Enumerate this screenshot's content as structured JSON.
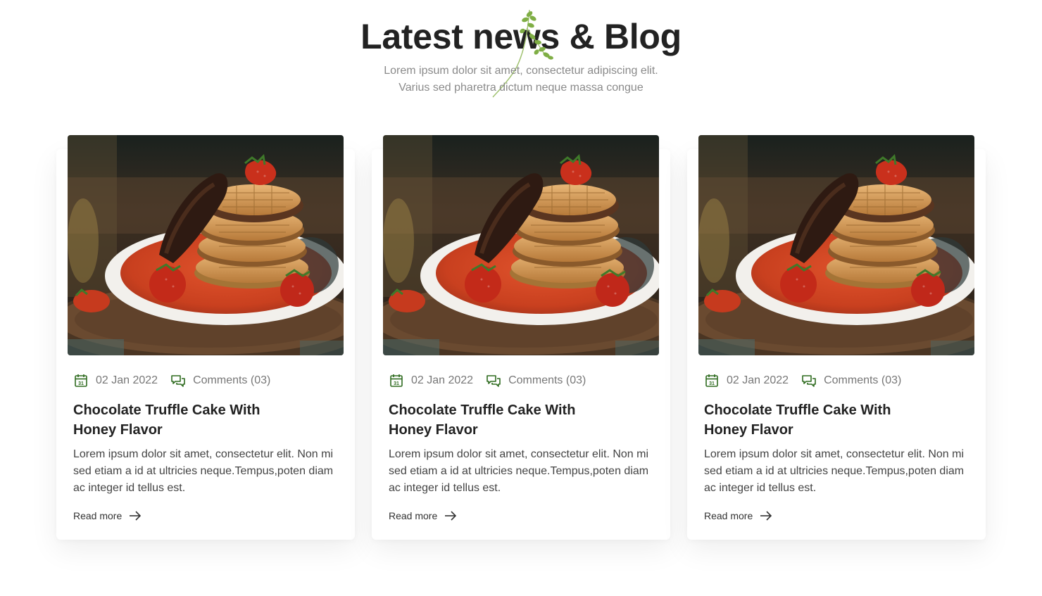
{
  "section": {
    "title": "Latest news & Blog",
    "subtitle_line1": "Lorem ipsum dolor sit amet, consectetur adipiscing elit.",
    "subtitle_line2": "Varius sed pharetra dictum neque massa congue"
  },
  "colors": {
    "accent_green": "#2e6b1f",
    "title": "#222222",
    "muted": "#8a8a8a"
  },
  "icons": {
    "date": "calendar-icon",
    "comments": "chat-bubbles-icon",
    "read_more": "arrow-right-icon",
    "decoration": "herb-sprig-icon"
  },
  "posts": [
    {
      "date": "02 Jan 2022",
      "comments": "Comments (03)",
      "title_line1": "Chocolate Truffle Cake With",
      "title_line2": "Honey Flavor",
      "excerpt_line1": "Lorem ipsum dolor sit amet, consectetur elit. Non mi",
      "excerpt_line2": "sed etiam a id at ultricies neque.Tempus,poten diam",
      "excerpt_line3": "ac integer id tellus est.",
      "read_more": "Read more"
    },
    {
      "date": "02 Jan 2022",
      "comments": "Comments (03)",
      "title_line1": "Chocolate Truffle Cake With",
      "title_line2": "Honey Flavor",
      "excerpt_line1": "Lorem ipsum dolor sit amet, consectetur elit. Non mi",
      "excerpt_line2": "sed etiam a id at ultricies neque.Tempus,poten diam",
      "excerpt_line3": "ac integer id tellus est.",
      "read_more": "Read more"
    },
    {
      "date": "02 Jan 2022",
      "comments": "Comments (03)",
      "title_line1": "Chocolate Truffle Cake With",
      "title_line2": "Honey Flavor",
      "excerpt_line1": "Lorem ipsum dolor sit amet, consectetur elit. Non mi",
      "excerpt_line2": "sed etiam a id at ultricies neque.Tempus,poten diam",
      "excerpt_line3": "ac integer id tellus est.",
      "read_more": "Read more"
    }
  ]
}
